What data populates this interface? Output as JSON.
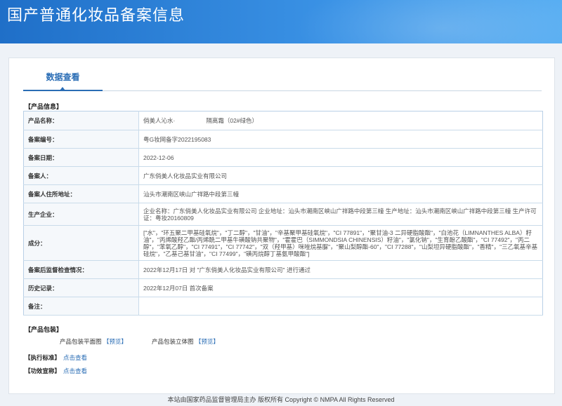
{
  "header": {
    "title": "国产普通化妆品备案信息"
  },
  "tab": {
    "label": "数据查看"
  },
  "product_info": {
    "section_title": "【产品信息】",
    "rows": [
      {
        "label": "产品名称：",
        "value_prefix": "俏美人沁水·",
        "value_suffix": "隔离霜（02#绿色）"
      },
      {
        "label": "备案编号：",
        "value": "粤G妆网备字2022195083"
      },
      {
        "label": "备案日期：",
        "value": "2022-12-06"
      },
      {
        "label": "备案人：",
        "value": "广东俏美人化妆品实业有限公司"
      },
      {
        "label": "备案人住所地址：",
        "value": "汕头市潮南区峡山广祥路中段第三幢"
      },
      {
        "label": "生产企业：",
        "value": "企业名称：广东俏美人化妆品实业有限公司 企业地址：汕头市潮南区峡山广祥路中段第三幢 生产地址：汕头市潮南区峡山广祥路中段第三幢 生产许可证：粤妆20160809"
      },
      {
        "label": "成分：",
        "value": "[\"水\"，\"环五聚二甲基硅氧烷\"，\"丁二醇\"，\"甘油\"，\"辛基聚甲基硅氧烷\"，\"CI 77891\"，\"聚甘油-3 二异硬脂酸酯\"，\"白池花（LIMNANTHES ALBA）籽油\"，\"丙烯酸羟乙酯/丙烯酰二甲基牛磺酸钠共聚物\"，\"霍霍巴（SIMMONDSIA CHINENSIS）籽油\"，\"氯化钠\"，\"生育酚乙酸酯\"，\"CI 77492\"，\"丙二醇\"，\"苯氧乙醇\"，\"CI 77491\"，\"CI 77742\"，\"双（羟甲基）咪唑烷基脲\"，\"聚山梨醇酯-60\"，\"CI 77288\"，\"山梨坦异硬脂酸酯\"，\"香精\"，\"三乙氧基辛基硅烷\"，\"乙基己基甘油\"，\"CI 77499\"，\"磺丙烷醇丁基氨甲酸酯\"]"
      },
      {
        "label": "备案后监督检查情况：",
        "value": "2022年12月17日 对 \"广东俏美人化妆品实业有限公司\" 进行通过"
      },
      {
        "label": "历史记录：",
        "value": "2022年12月07日 首次备案"
      },
      {
        "label": "备注：",
        "value": ""
      }
    ]
  },
  "packaging": {
    "section_title": "【产品包装】",
    "flat_label": "产品包装平面图",
    "flat_link": "【预览】",
    "solid_label": "产品包装立体图",
    "solid_link": "【预览】"
  },
  "standard": {
    "label": "【执行标准】",
    "link": "点击查看"
  },
  "efficacy": {
    "label": "【功效宣称】",
    "link": "点击查看"
  },
  "footer": {
    "text": "本站由国家药品监督管理局主办 版权所有 Copyright © NMPA All Rights Reserved"
  }
}
